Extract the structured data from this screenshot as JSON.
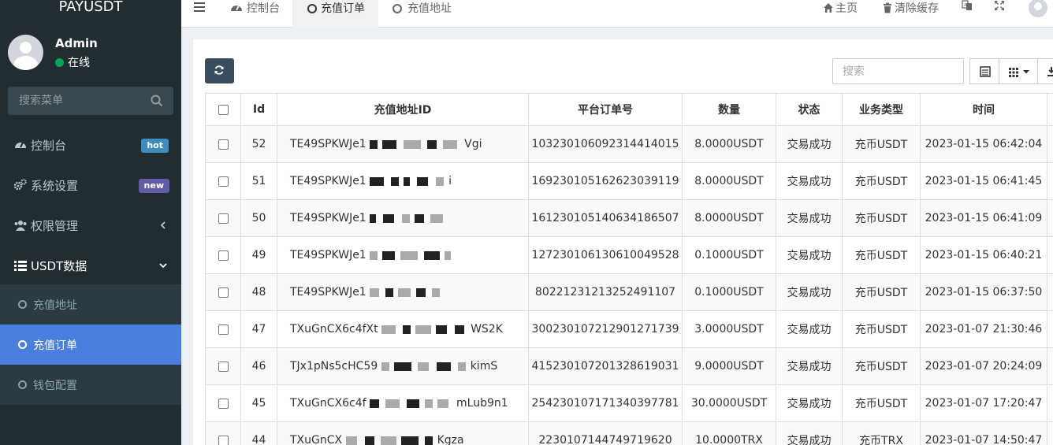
{
  "app": {
    "logo": "PAYUSDT"
  },
  "user": {
    "name": "Admin",
    "status": "在线"
  },
  "sidebar": {
    "search_placeholder": "搜索菜单",
    "items": [
      {
        "label": "控制台",
        "badge": "hot"
      },
      {
        "label": "系统设置",
        "badge": "new"
      },
      {
        "label": "权限管理"
      },
      {
        "label": "USDT数据"
      }
    ],
    "subitems": [
      {
        "label": "充值地址"
      },
      {
        "label": "充值订单"
      },
      {
        "label": "钱包配置"
      }
    ]
  },
  "topnav": {
    "tabs": [
      {
        "label": "控制台"
      },
      {
        "label": "充值订单"
      },
      {
        "label": "充值地址"
      }
    ],
    "home": "主页",
    "clear_cache": "清除缓存"
  },
  "toolbar": {
    "search_placeholder": "搜索"
  },
  "table": {
    "columns": [
      "Id",
      "充值地址ID",
      "平台订单号",
      "数量",
      "状态",
      "业务类型",
      "时间"
    ],
    "rows": [
      {
        "id": "52",
        "addr": "TE49SPKWJe1",
        "addr_tail": "Vgi",
        "order": "103230106092314414015",
        "amount": "8.0000USDT",
        "status": "交易成功",
        "type": "充币USDT",
        "time": "2023-01-15 06:42:04"
      },
      {
        "id": "51",
        "addr": "TE49SPKWJe1",
        "addr_tail": "i",
        "order": "169230105162623039119",
        "amount": "8.0000USDT",
        "status": "交易成功",
        "type": "充币USDT",
        "time": "2023-01-15 06:41:45"
      },
      {
        "id": "50",
        "addr": "TE49SPKWJe1",
        "addr_tail": "",
        "order": "161230105140634186507",
        "amount": "8.0000USDT",
        "status": "交易成功",
        "type": "充币USDT",
        "time": "2023-01-15 06:41:09"
      },
      {
        "id": "49",
        "addr": "TE49SPKWJe1",
        "addr_tail": "",
        "order": "127230106130610049528",
        "amount": "0.1000USDT",
        "status": "交易成功",
        "type": "充币USDT",
        "time": "2023-01-15 06:40:21"
      },
      {
        "id": "48",
        "addr": "TE49SPKWJe1",
        "addr_tail": "",
        "order": "80221231213252491107",
        "amount": "0.1000USDT",
        "status": "交易成功",
        "type": "充币USDT",
        "time": "2023-01-15 06:37:50"
      },
      {
        "id": "47",
        "addr": "TXuGnCX6c4fXt",
        "addr_tail": "WS2K",
        "order": "300230107212901271739",
        "amount": "3.0000USDT",
        "status": "交易成功",
        "type": "充币USDT",
        "time": "2023-01-07 21:30:46"
      },
      {
        "id": "46",
        "addr": "TJx1pNs5cHC59",
        "addr_tail": "kimS",
        "order": "415230107201328619031",
        "amount": "9.0000USDT",
        "status": "交易成功",
        "type": "充币USDT",
        "time": "2023-01-07 20:24:09"
      },
      {
        "id": "45",
        "addr": "TXuGnCX6c4f",
        "addr_tail": "mLub9n1",
        "order": "254230107171340397781",
        "amount": "30.0000USDT",
        "status": "交易成功",
        "type": "充币USDT",
        "time": "2023-01-07 17:20:47"
      },
      {
        "id": "44",
        "addr": "TXuGnCX",
        "addr_tail": "Kgza",
        "order": "2230107144749719620",
        "amount": "10.0000TRX",
        "status": "交易成功",
        "type": "充币TRX",
        "time": "2023-01-07 14:50:47"
      }
    ]
  }
}
